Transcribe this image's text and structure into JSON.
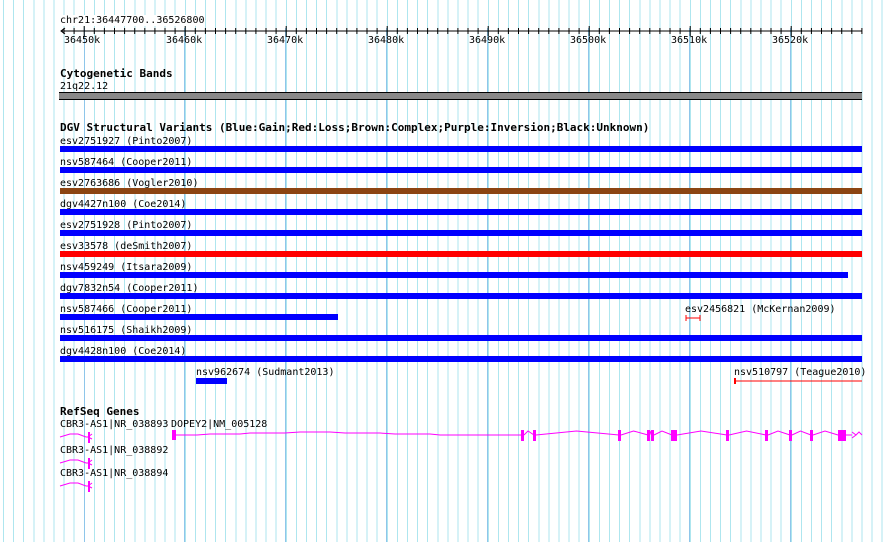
{
  "ruler": {
    "region": "chr21:36447700..36526800",
    "ticks": [
      "36450k",
      "36460k",
      "36470k",
      "36480k",
      "36490k",
      "36500k",
      "36510k",
      "36520k"
    ]
  },
  "cyto": {
    "title": "Cytogenetic Bands",
    "band": "21q22.12"
  },
  "dgv": {
    "title": "DGV Structural Variants (Blue:Gain;Red:Loss;Brown:Complex;Purple:Inversion;Black:Unknown)",
    "colors": {
      "gain": "#0000ff",
      "loss": "#ff0000",
      "complex": "#8b4513"
    },
    "variants": [
      {
        "label": "esv2751927 (Pinto2007)",
        "type": "gain"
      },
      {
        "label": "nsv587464 (Cooper2011)",
        "type": "gain"
      },
      {
        "label": "esv2763686 (Vogler2010)",
        "type": "complex"
      },
      {
        "label": "dgv4427n100 (Coe2014)",
        "type": "gain"
      },
      {
        "label": "esv2751928 (Pinto2007)",
        "type": "gain"
      },
      {
        "label": "esv33578 (deSmith2007)",
        "type": "loss"
      },
      {
        "label": "nsv459249 (Itsara2009)",
        "type": "gain"
      },
      {
        "label": "dgv7832n54 (Cooper2011)",
        "type": "gain"
      },
      {
        "label": "nsv587466 (Cooper2011)",
        "type": "gain"
      },
      {
        "label": "esv2456821 (McKernan2009)",
        "type": "loss"
      },
      {
        "label": "nsv516175 (Shaikh2009)",
        "type": "gain"
      },
      {
        "label": "dgv4428n100 (Coe2014)",
        "type": "gain"
      },
      {
        "label": "nsv962674 (Sudmant2013)",
        "type": "gain"
      },
      {
        "label": "nsv510797 (Teague2010)",
        "type": "loss"
      }
    ]
  },
  "genes": {
    "title": "RefSeq Genes",
    "color": "#ff00ff",
    "items": [
      {
        "label": "CBR3-AS1|NR_038893"
      },
      {
        "label": "DOPEY2|NM_005128"
      },
      {
        "label": "CBR3-AS1|NR_038892"
      },
      {
        "label": "CBR3-AS1|NR_038894"
      }
    ]
  }
}
